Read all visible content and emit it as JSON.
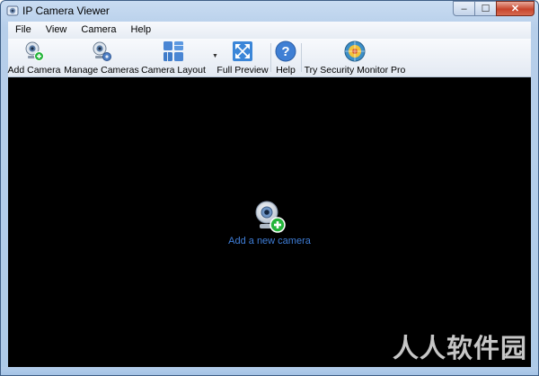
{
  "window": {
    "title": "IP Camera Viewer"
  },
  "window_controls": {
    "minimize": "–",
    "maximize": "☐",
    "close": "✕"
  },
  "menu": [
    "File",
    "View",
    "Camera",
    "Help"
  ],
  "toolbar": {
    "add_camera": "Add Camera",
    "manage_cameras": "Manage Cameras",
    "camera_layout": "Camera Layout",
    "full_preview": "Full Preview",
    "help": "Help",
    "try_pro": "Try Security Monitor Pro"
  },
  "main": {
    "add_new_camera_link": "Add a new camera"
  },
  "watermark": "人人软件园",
  "colors": {
    "link": "#3f7ed8",
    "viewport_bg": "#000000",
    "accent_green": "#23b43a"
  }
}
